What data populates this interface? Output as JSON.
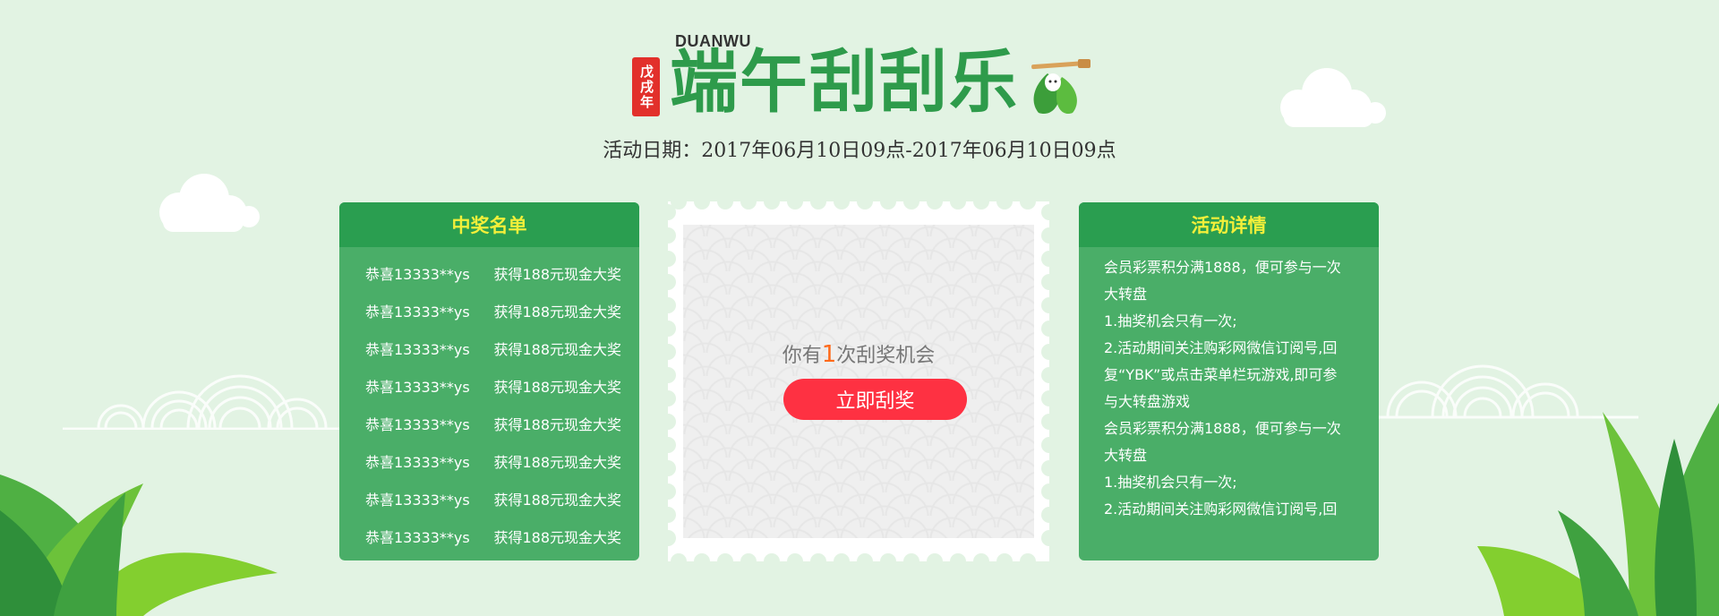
{
  "header": {
    "seal_text": "戊戌年",
    "english_title": "DUANWU",
    "main_title": "端午刮刮乐",
    "date_range": "活动日期：2017年06月10日09点-2017年06月10日09点"
  },
  "winners_panel": {
    "title": "中奖名单",
    "rows": [
      {
        "name": "恭喜13333**ys",
        "prize": "获得188元现金大奖"
      },
      {
        "name": "恭喜13333**ys",
        "prize": "获得188元现金大奖"
      },
      {
        "name": "恭喜13333**ys",
        "prize": "获得188元现金大奖"
      },
      {
        "name": "恭喜13333**ys",
        "prize": "获得188元现金大奖"
      },
      {
        "name": "恭喜13333**ys",
        "prize": "获得188元现金大奖"
      },
      {
        "name": "恭喜13333**ys",
        "prize": "获得188元现金大奖"
      },
      {
        "name": "恭喜13333**ys",
        "prize": "获得188元现金大奖"
      },
      {
        "name": "恭喜13333**ys",
        "prize": "获得188元现金大奖"
      }
    ]
  },
  "scratch_card": {
    "chance_prefix": "你有",
    "chance_count": "1",
    "chance_suffix": "次刮奖机会",
    "button_label": "立即刮奖"
  },
  "details_panel": {
    "title": "活动详情",
    "lines": [
      "会员彩票积分满1888，便可参与一次",
      "大转盘",
      "1.抽奖机会只有一次;",
      "2.活动期间关注购彩网微信订阅号,回",
      "复“YBK”或点击菜单栏玩游戏,即可参",
      "与大转盘游戏",
      "会员彩票积分满1888，便可参与一次",
      "大转盘",
      "1.抽奖机会只有一次;",
      "2.活动期间关注购彩网微信订阅号,回"
    ]
  },
  "colors": {
    "background": "#e2f3e3",
    "panel": "#4aae68",
    "panel_header": "#2a9e50",
    "panel_title": "#f3ef3a",
    "title_green": "#2e9b4b",
    "seal_red": "#e2302b",
    "button_red": "#fe3142",
    "count_orange": "#ff6a1a"
  }
}
